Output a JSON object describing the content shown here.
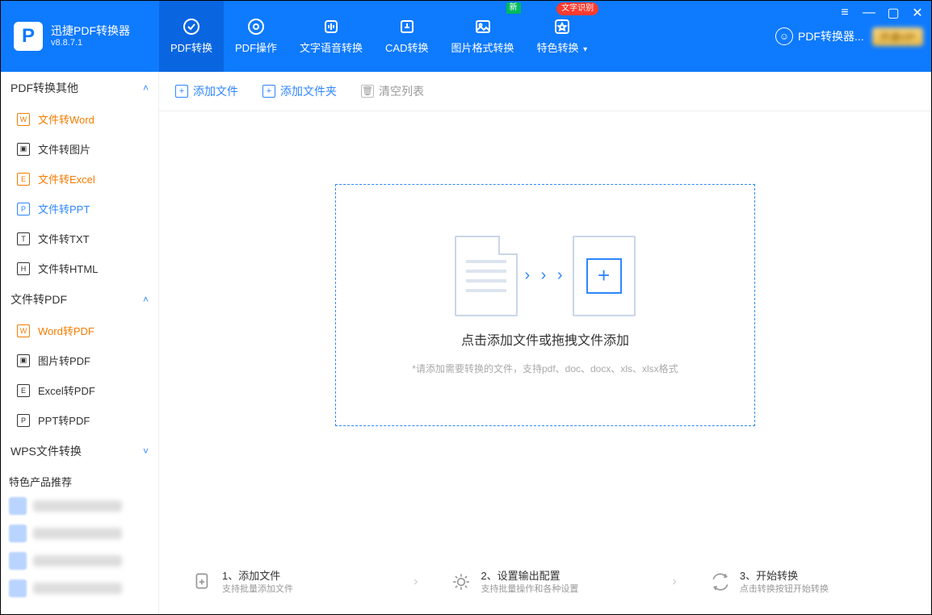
{
  "brand": {
    "title": "迅捷PDF转换器",
    "version": "v8.8.7.1",
    "logo_letter": "P"
  },
  "window": {
    "menu": "≡",
    "minimize": "—",
    "maximize": "▢",
    "close": "✕"
  },
  "tabs": [
    {
      "label": "PDF转换",
      "icon": "convert"
    },
    {
      "label": "PDF操作",
      "icon": "gear"
    },
    {
      "label": "文字语音转换",
      "icon": "audio"
    },
    {
      "label": "CAD转换",
      "icon": "cad"
    },
    {
      "label": "图片格式转换",
      "icon": "image",
      "badge": "新"
    },
    {
      "label": "特色转换",
      "icon": "star",
      "dropdown": true,
      "badge_text": "文字识别"
    }
  ],
  "active_tab": 0,
  "user": {
    "label": "PDF转换器..."
  },
  "sidebar": {
    "groups": [
      {
        "title": "PDF转换其他",
        "open": true,
        "items": [
          {
            "label": "文件转Word",
            "style": "orange",
            "glyph": "W"
          },
          {
            "label": "文件转图片",
            "glyph": "▣"
          },
          {
            "label": "文件转Excel",
            "style": "orange",
            "glyph": "E"
          },
          {
            "label": "文件转PPT",
            "style": "active",
            "glyph": "P"
          },
          {
            "label": "文件转TXT",
            "glyph": "T"
          },
          {
            "label": "文件转HTML",
            "glyph": "H"
          }
        ]
      },
      {
        "title": "文件转PDF",
        "open": true,
        "items": [
          {
            "label": "Word转PDF",
            "style": "orange",
            "glyph": "W"
          },
          {
            "label": "图片转PDF",
            "glyph": "▣"
          },
          {
            "label": "Excel转PDF",
            "glyph": "E"
          },
          {
            "label": "PPT转PDF",
            "glyph": "P"
          }
        ]
      },
      {
        "title": "WPS文件转换",
        "open": false,
        "items": []
      }
    ],
    "promo_title": "特色产品推荐"
  },
  "toolbar": {
    "add_file": "添加文件",
    "add_folder": "添加文件夹",
    "clear": "清空列表"
  },
  "drop": {
    "title": "点击添加文件或拖拽文件添加",
    "sub": "*请添加需要转换的文件，支持pdf、doc、docx、xls、xlsx格式"
  },
  "steps": [
    {
      "n": "1、",
      "title": "添加文件",
      "sub": "支持批量添加文件"
    },
    {
      "n": "2、",
      "title": "设置输出配置",
      "sub": "支持批量操作和各种设置"
    },
    {
      "n": "3、",
      "title": "开始转换",
      "sub": "点击转换按钮开始转换"
    }
  ]
}
